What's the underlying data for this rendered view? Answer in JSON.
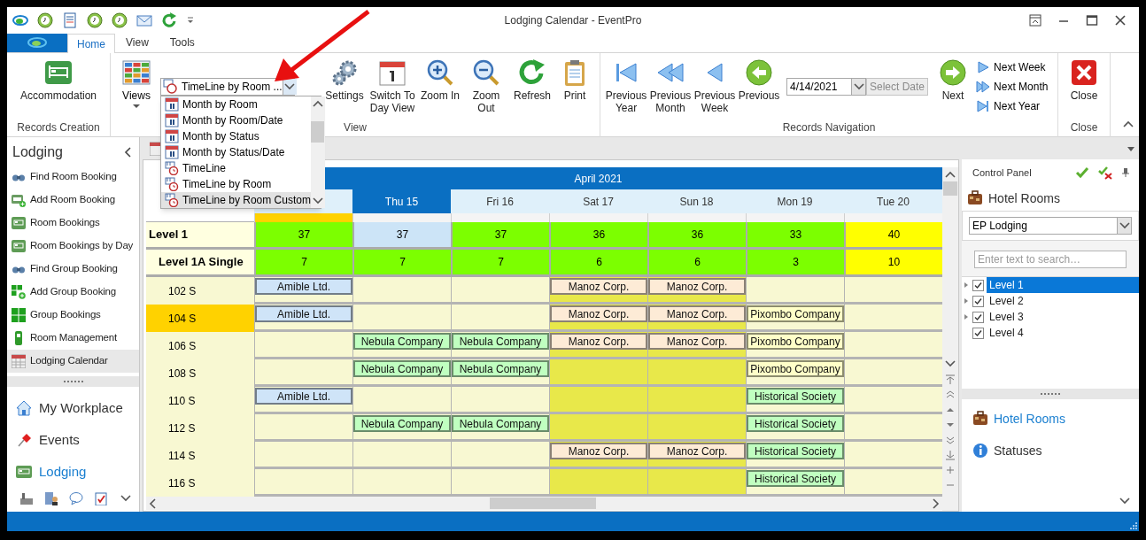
{
  "window": {
    "title": "Lodging Calendar - EventPro"
  },
  "tabs": [
    {
      "label": "Home",
      "selected": true
    },
    {
      "label": "View",
      "selected": false
    },
    {
      "label": "Tools",
      "selected": false
    }
  ],
  "ribbon": {
    "records_creation": {
      "label": "Records Creation",
      "button": {
        "label": "Accommodation"
      }
    },
    "view": {
      "label": "View",
      "views_button": {
        "label": "Views"
      },
      "combo": {
        "value": "TimeLine by Room ...",
        "expanded": true,
        "options": [
          {
            "label": "Month by Room",
            "kind": "month",
            "selected": false
          },
          {
            "label": "Month by Room/Date",
            "kind": "month",
            "selected": false
          },
          {
            "label": "Month by Status",
            "kind": "month",
            "selected": false
          },
          {
            "label": "Month by Status/Date",
            "kind": "month",
            "selected": false
          },
          {
            "label": "TimeLine",
            "kind": "timeline",
            "selected": false
          },
          {
            "label": "TimeLine by Room",
            "kind": "timeline",
            "selected": false
          },
          {
            "label": "TimeLine by Room Custom",
            "kind": "timeline",
            "selected": true
          }
        ]
      },
      "buttons": [
        {
          "label": "Settings",
          "kind": "settings"
        },
        {
          "label": "Switch To Day View",
          "kind": "day"
        },
        {
          "label": "Zoom In",
          "kind": "zoom-in"
        },
        {
          "label": "Zoom Out",
          "kind": "zoom-out"
        },
        {
          "label": "Refresh",
          "kind": "refresh"
        },
        {
          "label": "Print",
          "kind": "print"
        }
      ]
    },
    "navigation": {
      "label": "Records Navigation",
      "back_buttons": [
        {
          "label": "Previous Year",
          "kind": "prev-year"
        },
        {
          "label": "Previous Month",
          "kind": "prev-month"
        },
        {
          "label": "Previous Week",
          "kind": "prev-week"
        },
        {
          "label": "Previous",
          "kind": "prev"
        }
      ],
      "date": {
        "value": "4/14/2021",
        "button": {
          "label": "Select Date",
          "disabled": true
        }
      },
      "next_button": {
        "label": "Next"
      },
      "small_buttons": [
        {
          "label": "Next Week",
          "kind": "next-week"
        },
        {
          "label": "Next Month",
          "kind": "next-month"
        },
        {
          "label": "Next Year",
          "kind": "next-year"
        }
      ]
    },
    "close": {
      "label": "Close",
      "button": {
        "label": "Close"
      }
    }
  },
  "sidebar": {
    "title": "Lodging",
    "items": [
      {
        "label": "Find Room Booking",
        "kind": "find",
        "selected": false
      },
      {
        "label": "Add Room Booking",
        "kind": "add-bed",
        "selected": false
      },
      {
        "label": "Room Bookings",
        "kind": "bed",
        "selected": false
      },
      {
        "label": "Room Bookings by Day",
        "kind": "bed",
        "selected": false
      },
      {
        "label": "Find Group Booking",
        "kind": "find",
        "selected": false
      },
      {
        "label": "Add Group Booking",
        "kind": "add-group",
        "selected": false
      },
      {
        "label": "Group Bookings",
        "kind": "group",
        "selected": false
      },
      {
        "label": "Room Management",
        "kind": "device",
        "selected": false
      },
      {
        "label": "Lodging Calendar",
        "kind": "calendar",
        "selected": true
      }
    ],
    "nav": [
      {
        "label": "My Workplace",
        "kind": "house",
        "selected": false
      },
      {
        "label": "Events",
        "kind": "pin",
        "selected": false
      },
      {
        "label": "Lodging",
        "kind": "bed",
        "selected": true
      }
    ]
  },
  "calendar": {
    "month": "April 2021",
    "columns": [
      {
        "selected": false,
        "today": true,
        "weekend": false
      },
      {
        "label": "Thu 15",
        "selected": true,
        "today": false,
        "weekend": false
      },
      {
        "label": "Fri 16",
        "selected": false,
        "today": false,
        "weekend": false
      },
      {
        "label": "Sat 17",
        "selected": false,
        "today": false,
        "weekend": true
      },
      {
        "label": "Sun 18",
        "selected": false,
        "today": false,
        "weekend": true
      },
      {
        "label": "Mon 19",
        "selected": false,
        "today": false,
        "weekend": false
      },
      {
        "label": "Tue 20",
        "selected": false,
        "today": false,
        "weekend": false
      }
    ],
    "summary_rows": [
      {
        "label": "Level 1",
        "kind": "level",
        "cells": [
          {
            "value": "37",
            "color": "#7cff00"
          },
          {
            "value": "37",
            "color": "#cce4f7"
          },
          {
            "value": "37",
            "color": "#7cff00"
          },
          {
            "value": "36",
            "color": "#7cff00"
          },
          {
            "value": "36",
            "color": "#7cff00"
          },
          {
            "value": "33",
            "color": "#7cff00"
          },
          {
            "value": "40",
            "color": "#ffff00"
          }
        ]
      },
      {
        "label": "Level 1A Single",
        "kind": "sublevel",
        "cells": [
          {
            "value": "7",
            "color": "#7cff00"
          },
          {
            "value": "7",
            "color": "#7cff00"
          },
          {
            "value": "7",
            "color": "#7cff00"
          },
          {
            "value": "6",
            "color": "#7cff00"
          },
          {
            "value": "6",
            "color": "#7cff00"
          },
          {
            "value": "3",
            "color": "#7cff00"
          },
          {
            "value": "10",
            "color": "#ffff00"
          }
        ]
      }
    ],
    "rooms": [
      {
        "label": "102 S",
        "selected": false,
        "cells": [
          {
            "kind": "booking",
            "text": "Amible Ltd.",
            "color": "#cfe4f8"
          },
          {
            "kind": "empty"
          },
          {
            "kind": "empty"
          },
          {
            "kind": "booking",
            "text": "Manoz Corp.",
            "color": "#fdebd6"
          },
          {
            "kind": "booking",
            "text": "Manoz Corp.",
            "color": "#fdebd6"
          },
          {
            "kind": "empty"
          },
          {
            "kind": "empty"
          }
        ]
      },
      {
        "label": "104 S",
        "selected": true,
        "cells": [
          {
            "kind": "booking",
            "text": "Amible Ltd.",
            "color": "#cfe4f8"
          },
          {
            "kind": "empty"
          },
          {
            "kind": "empty"
          },
          {
            "kind": "booking",
            "text": "Manoz Corp.",
            "color": "#fdebd6"
          },
          {
            "kind": "booking",
            "text": "Manoz Corp.",
            "color": "#fdebd6"
          },
          {
            "kind": "booking",
            "text": "Pixombo Company",
            "color": "#ffffc8"
          },
          {
            "kind": "empty"
          }
        ]
      },
      {
        "label": "106 S",
        "selected": false,
        "cells": [
          {
            "kind": "empty"
          },
          {
            "kind": "booking",
            "text": "Nebula Company",
            "color": "#c0ffc0"
          },
          {
            "kind": "booking",
            "text": "Nebula Company",
            "color": "#c0ffc0"
          },
          {
            "kind": "booking",
            "text": "Manoz Corp.",
            "color": "#fdebd6"
          },
          {
            "kind": "booking",
            "text": "Manoz Corp.",
            "color": "#fdebd6"
          },
          {
            "kind": "booking",
            "text": "Pixombo Company",
            "color": "#ffffc8"
          },
          {
            "kind": "empty"
          }
        ]
      },
      {
        "label": "108 S",
        "selected": false,
        "cells": [
          {
            "kind": "empty"
          },
          {
            "kind": "booking",
            "text": "Nebula Company",
            "color": "#c0ffc0"
          },
          {
            "kind": "booking",
            "text": "Nebula Company",
            "color": "#c0ffc0"
          },
          {
            "kind": "empty"
          },
          {
            "kind": "empty"
          },
          {
            "kind": "booking",
            "text": "Pixombo Company",
            "color": "#ffffc8"
          },
          {
            "kind": "empty"
          }
        ]
      },
      {
        "label": "110 S",
        "selected": false,
        "cells": [
          {
            "kind": "booking",
            "text": "Amible Ltd.",
            "color": "#cfe4f8"
          },
          {
            "kind": "empty"
          },
          {
            "kind": "empty"
          },
          {
            "kind": "empty"
          },
          {
            "kind": "empty"
          },
          {
            "kind": "booking",
            "text": "Historical Society",
            "color": "#c0ffc0"
          },
          {
            "kind": "empty"
          }
        ]
      },
      {
        "label": "112 S",
        "selected": false,
        "cells": [
          {
            "kind": "empty"
          },
          {
            "kind": "booking",
            "text": "Nebula Company",
            "color": "#c0ffc0"
          },
          {
            "kind": "booking",
            "text": "Nebula Company",
            "color": "#c0ffc0"
          },
          {
            "kind": "empty"
          },
          {
            "kind": "empty"
          },
          {
            "kind": "booking",
            "text": "Historical Society",
            "color": "#c0ffc0"
          },
          {
            "kind": "empty"
          }
        ]
      },
      {
        "label": "114 S",
        "selected": false,
        "cells": [
          {
            "kind": "empty"
          },
          {
            "kind": "empty"
          },
          {
            "kind": "empty"
          },
          {
            "kind": "booking",
            "text": "Manoz Corp.",
            "color": "#fdebd6"
          },
          {
            "kind": "booking",
            "text": "Manoz Corp.",
            "color": "#fdebd6"
          },
          {
            "kind": "booking",
            "text": "Historical Society",
            "color": "#c0ffc0"
          },
          {
            "kind": "empty"
          }
        ]
      },
      {
        "label": "116 S",
        "selected": false,
        "cells": [
          {
            "kind": "empty"
          },
          {
            "kind": "empty"
          },
          {
            "kind": "empty"
          },
          {
            "kind": "empty"
          },
          {
            "kind": "empty"
          },
          {
            "kind": "booking",
            "text": "Historical Society",
            "color": "#c0ffc0"
          },
          {
            "kind": "empty"
          }
        ]
      }
    ]
  },
  "control_panel": {
    "title": "Control Panel",
    "section_title": "Hotel Rooms",
    "select": {
      "value": "EP Lodging"
    },
    "search": {
      "placeholder": "Enter text to search…"
    },
    "tree": [
      {
        "label": "Level 1",
        "checked": true,
        "selected": true,
        "expandable": true
      },
      {
        "label": "Level 2",
        "checked": true,
        "selected": false,
        "expandable": true
      },
      {
        "label": "Level 3",
        "checked": true,
        "selected": false,
        "expandable": true
      },
      {
        "label": "Level 4",
        "checked": true,
        "selected": false,
        "expandable": false
      }
    ],
    "nav": [
      {
        "label": "Hotel Rooms",
        "kind": "suitcase",
        "selected": true
      },
      {
        "label": "Statuses",
        "kind": "info",
        "selected": false
      }
    ]
  }
}
